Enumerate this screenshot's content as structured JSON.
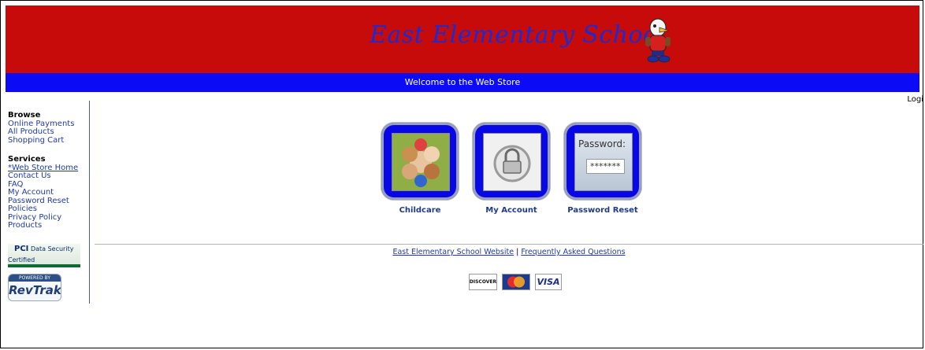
{
  "header": {
    "school_name": "East Elementary School",
    "welcome": "Welcome to the Web Store",
    "login": "Logi"
  },
  "sidebar": {
    "browse_heading": "Browse",
    "browse_items": [
      "Online Payments",
      "All Products",
      "Shopping Cart"
    ],
    "services_heading": "Services",
    "services_items": [
      "*Web Store Home",
      "Contact Us",
      "FAQ",
      "My Account",
      "Password Reset",
      "Policies",
      "Privacy Policy",
      "Products"
    ],
    "pci_badge": "PCI",
    "pci_text": "Data Security Certified",
    "revtrak_top": "POWERED BY",
    "revtrak_brand": "RevTrak"
  },
  "tiles": [
    {
      "label": "Childcare",
      "icon": "children-photo"
    },
    {
      "label": "My Account",
      "icon": "padlock"
    },
    {
      "label": "Password Reset",
      "icon": "password-field"
    }
  ],
  "password_tile_text": "Password:",
  "password_tile_stars": "*******",
  "footer": {
    "link1": "East Elementary School Website",
    "separator": "|",
    "link2": "Frequently Asked Questions",
    "card_discover": "DISCOVER",
    "card_visa": "VISA"
  },
  "colors": {
    "banner": "#c70b0b",
    "welcome_bar": "#0b0bf5",
    "tile": "#0707e8",
    "link": "#1f3aa8"
  }
}
